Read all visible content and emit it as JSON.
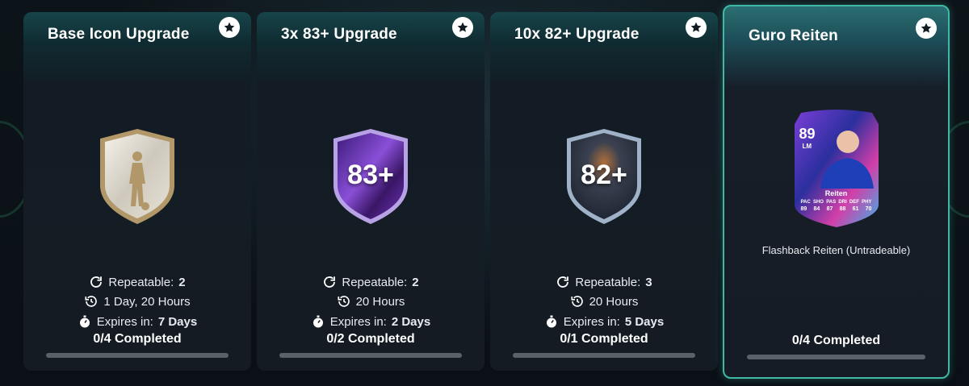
{
  "cards": [
    {
      "title": "Base Icon Upgrade",
      "badge_label": "",
      "repeatable_label": "Repeatable:",
      "repeatable_value": "2",
      "time_left": "1 Day, 20 Hours",
      "expires_label": "Expires in:",
      "expires_value": "7 Days",
      "completed": "0/4 Completed",
      "progress": 0
    },
    {
      "title": "3x 83+ Upgrade",
      "badge_label": "83+",
      "repeatable_label": "Repeatable:",
      "repeatable_value": "2",
      "time_left": "20 Hours",
      "expires_label": "Expires in:",
      "expires_value": "2 Days",
      "completed": "0/2 Completed",
      "progress": 0
    },
    {
      "title": "10x 82+ Upgrade",
      "badge_label": "82+",
      "repeatable_label": "Repeatable:",
      "repeatable_value": "3",
      "time_left": "20 Hours",
      "expires_label": "Expires in:",
      "expires_value": "5 Days",
      "completed": "0/1 Completed",
      "progress": 0
    },
    {
      "title": "Guro Reiten",
      "reward_name": "Flashback Reiten (Untradeable)",
      "player": {
        "rating": "89",
        "position": "LM",
        "name": "Reiten",
        "stat_labels": [
          "PAC",
          "SHO",
          "PAS",
          "DRI",
          "DEF",
          "PHY"
        ],
        "stat_values": [
          "89",
          "84",
          "87",
          "88",
          "61",
          "70"
        ]
      },
      "completed": "0/4 Completed",
      "progress": 0
    }
  ],
  "icons": {
    "favorite": "star-circle-icon",
    "repeat": "refresh-icon",
    "time": "history-clock-icon",
    "expires": "stopwatch-icon"
  },
  "colors": {
    "accent": "#3fb8a6",
    "progress_fill": "#b6e1d6",
    "progress_track": "#5a6168"
  }
}
